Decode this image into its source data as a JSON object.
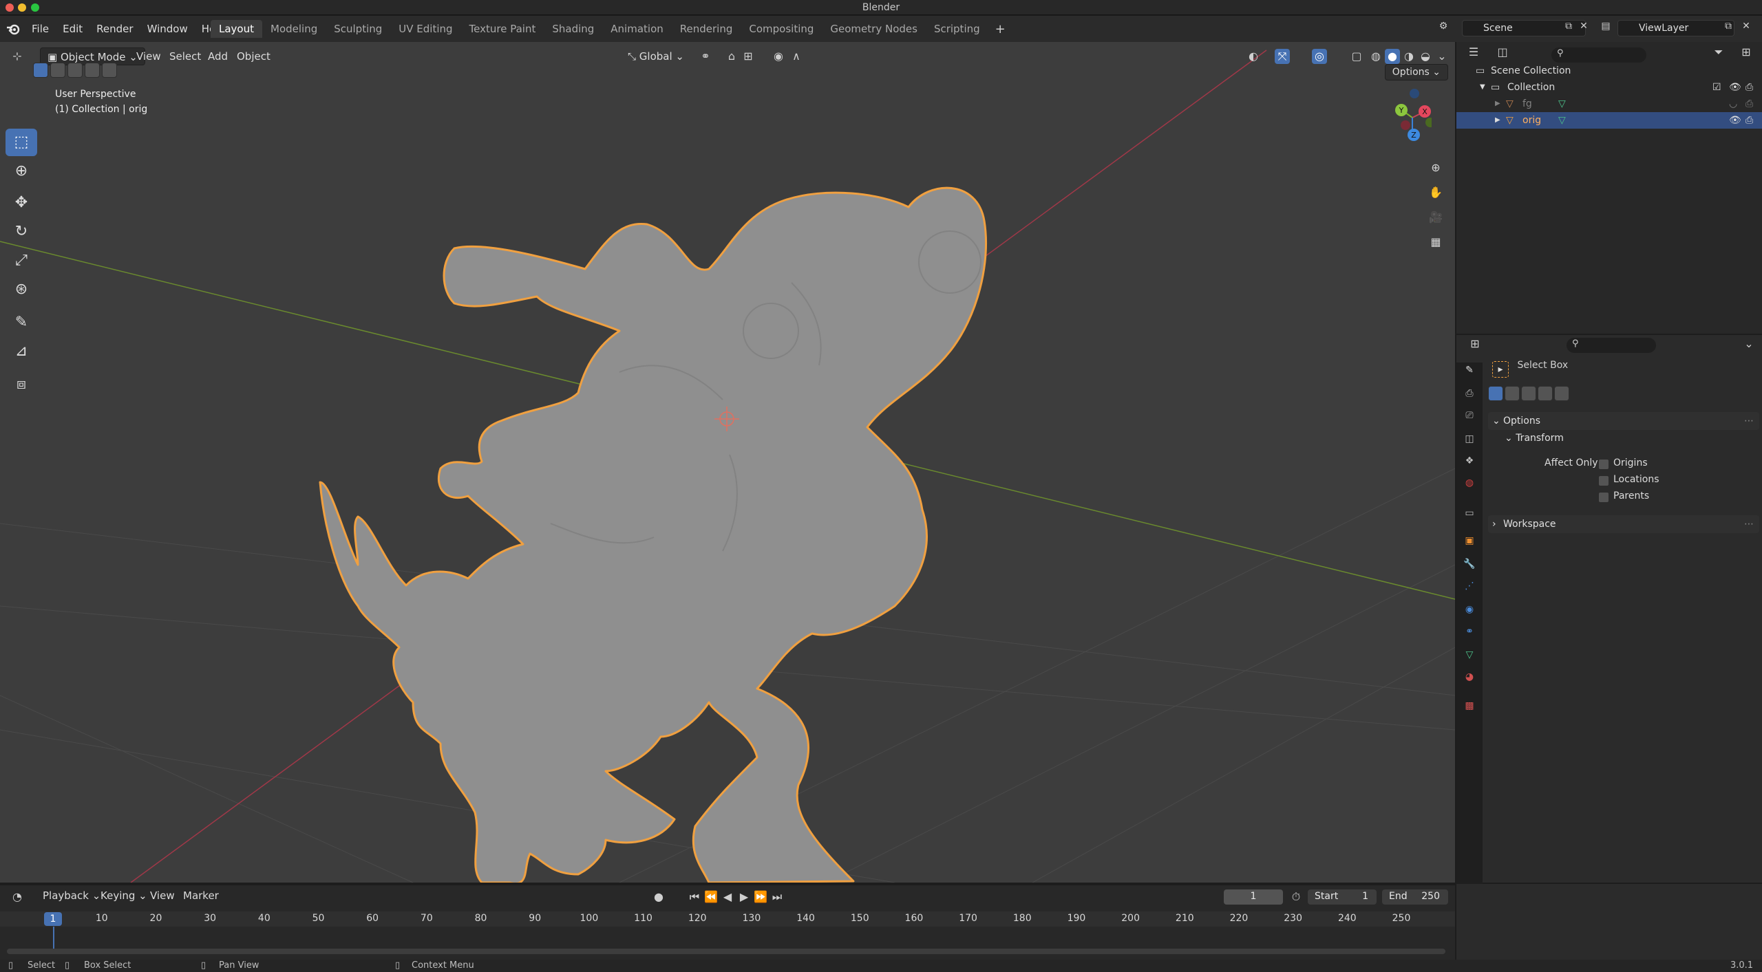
{
  "window": {
    "title": "Blender"
  },
  "menus": [
    "File",
    "Edit",
    "Render",
    "Window",
    "Help"
  ],
  "workspaces": [
    "Layout",
    "Modeling",
    "Sculpting",
    "UV Editing",
    "Texture Paint",
    "Shading",
    "Animation",
    "Rendering",
    "Compositing",
    "Geometry Nodes",
    "Scripting"
  ],
  "active_workspace": "Layout",
  "scene": {
    "name": "Scene",
    "view_layer": "ViewLayer"
  },
  "viewport": {
    "mode": "Object Mode",
    "menus": [
      "View",
      "Select",
      "Add",
      "Object"
    ],
    "orientation": "Global",
    "options_label": "Options",
    "perspective_label": "User Perspective",
    "collection_label": "(1) Collection | orig",
    "gizmo_axes": [
      "X",
      "Y",
      "Z"
    ],
    "colors": {
      "background": "#3d3d3d",
      "selection_outline": "#f0a040",
      "x_axis": "#b04050",
      "y_axis": "#7a9f30",
      "accent": "#4772b3"
    }
  },
  "tools": [
    "select-box-icon",
    "cursor-icon",
    "move-icon",
    "rotate-icon",
    "scale-icon",
    "transform-icon",
    "annotate-icon",
    "measure-icon",
    "add-cube-icon"
  ],
  "outliner": {
    "rows": [
      {
        "label": "Scene Collection",
        "indent": 0
      },
      {
        "label": "Collection",
        "indent": 1
      },
      {
        "label": "fg",
        "indent": 2
      },
      {
        "label": "orig",
        "indent": 2
      }
    ],
    "selected": "orig"
  },
  "properties": {
    "tool_name": "Select Box",
    "panels": {
      "options": "Options",
      "transform": "Transform",
      "affect_only": "Affect Only",
      "origins": "Origins",
      "locations": "Locations",
      "parents": "Parents",
      "workspace": "Workspace"
    }
  },
  "timeline": {
    "menus": [
      "Playback",
      "Keying",
      "View",
      "Marker"
    ],
    "current_frame": "1",
    "start_label": "Start",
    "start": "1",
    "end_label": "End",
    "end": "250",
    "ruler": [
      "1",
      "10",
      "20",
      "30",
      "40",
      "50",
      "60",
      "70",
      "80",
      "90",
      "100",
      "110",
      "120",
      "130",
      "140",
      "150",
      "160",
      "170",
      "180",
      "190",
      "200",
      "210",
      "220",
      "230",
      "240",
      "250"
    ]
  },
  "status": {
    "select": "Select",
    "box_select": "Box Select",
    "pan_view": "Pan View",
    "context_menu": "Context Menu",
    "version": "3.0.1"
  }
}
